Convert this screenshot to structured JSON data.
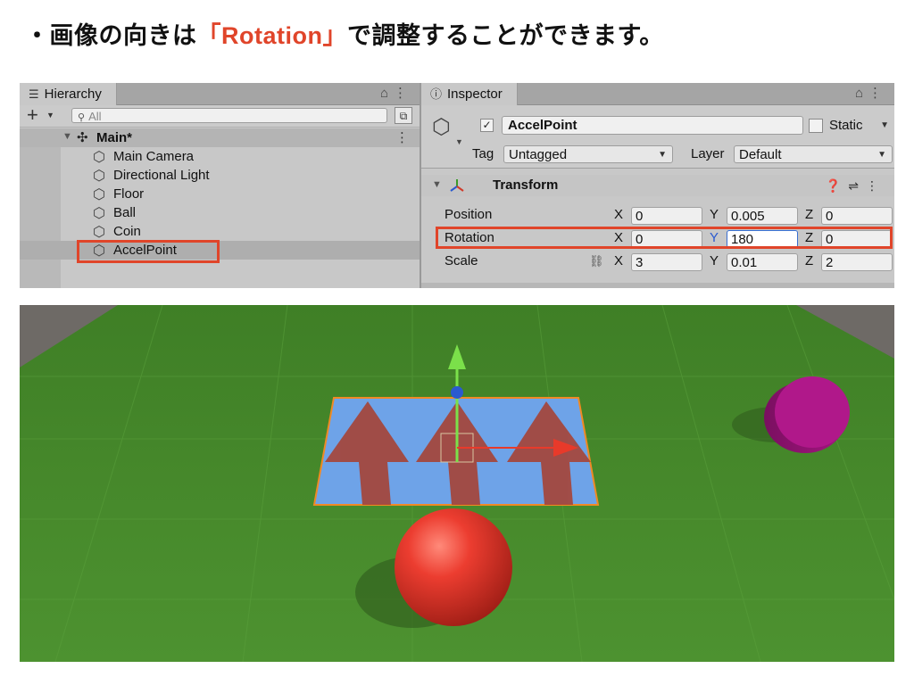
{
  "headline": {
    "bullet": "・",
    "before": "画像の向きは",
    "highlight": "「Rotation」",
    "after": "で調整することができます。",
    "highlight_color": "#e0452a"
  },
  "hierarchy": {
    "tab_label": "Hierarchy",
    "tab_icon": "list-icon",
    "lock_icon": "lock-icon",
    "menu_icon": "kebab-menu-icon",
    "add_label": "+",
    "search_placeholder": "All",
    "scene_name": "Main*",
    "items": [
      {
        "label": "Main Camera"
      },
      {
        "label": "Directional Light"
      },
      {
        "label": "Floor"
      },
      {
        "label": "Ball"
      },
      {
        "label": "Coin"
      },
      {
        "label": "AccelPoint"
      }
    ],
    "selected_item": "AccelPoint"
  },
  "inspector": {
    "tab_label": "Inspector",
    "object_name": "AccelPoint",
    "active_checked": true,
    "static_label": "Static",
    "static_checked": false,
    "tag_label": "Tag",
    "tag_value": "Untagged",
    "layer_label": "Layer",
    "layer_value": "Default",
    "component_name": "Transform",
    "transform": {
      "position": {
        "label": "Position",
        "x": "0",
        "y": "0.005",
        "z": "0"
      },
      "rotation": {
        "label": "Rotation",
        "x": "0",
        "y": "180",
        "z": "0"
      },
      "scale": {
        "label": "Scale",
        "x": "3",
        "y": "0.01",
        "z": "2"
      }
    },
    "axis_labels": {
      "x": "X",
      "y": "Y",
      "z": "Z"
    }
  },
  "scene": {
    "floor_color": "#4a8a2c",
    "panel_color": "#6ea3e8",
    "arrow_color": "#a5453a",
    "ball_color": "#e23a2e",
    "coin_color": "#b0188a",
    "selection_outline_color": "#f08a24"
  }
}
